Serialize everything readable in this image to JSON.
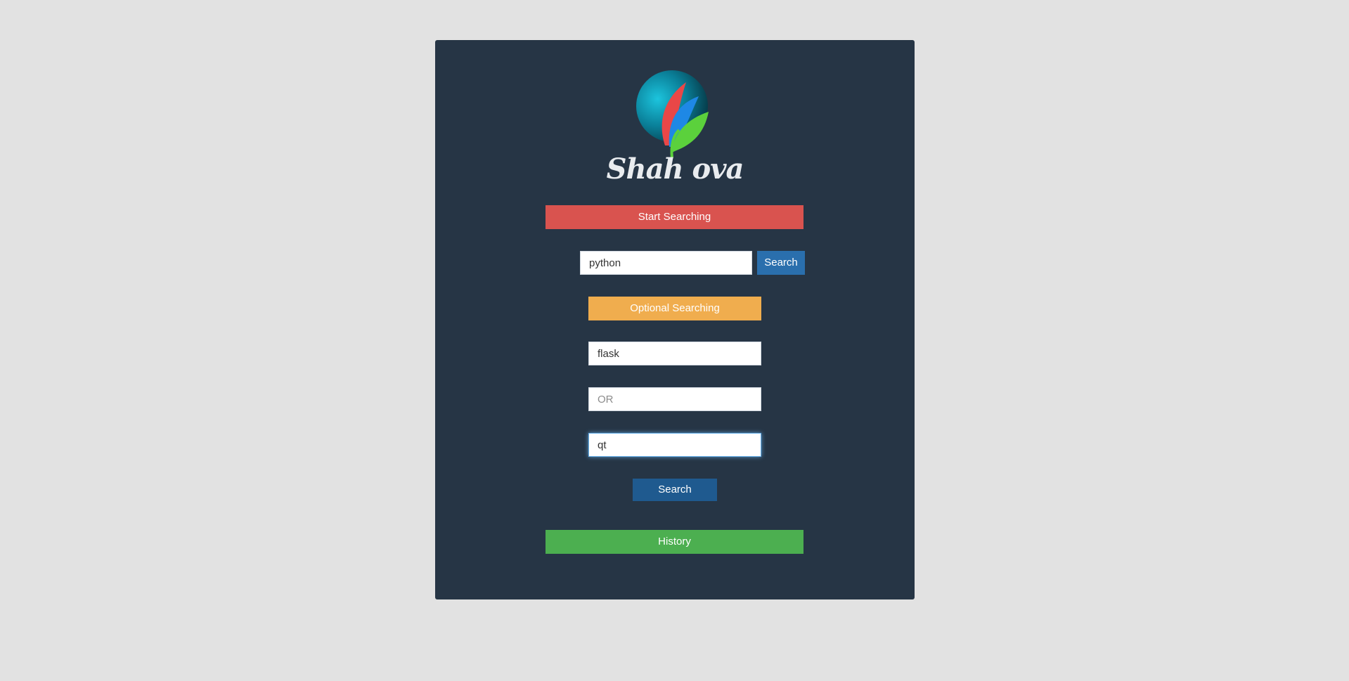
{
  "brand": {
    "name": "Shah ova"
  },
  "buttons": {
    "start_searching": "Start Searching",
    "search_inline": "Search",
    "optional_searching": "Optional Searching",
    "search_main": "Search",
    "history": "History"
  },
  "inputs": {
    "main_query": {
      "value": "python"
    },
    "optional_1": {
      "value": "flask"
    },
    "optional_2": {
      "value": "",
      "placeholder": "OR"
    },
    "optional_3": {
      "value": "qt"
    }
  },
  "colors": {
    "page_bg": "#e2e2e2",
    "panel_bg": "#263545",
    "start": "#d9534f",
    "optional": "#f0ad4e",
    "history": "#4caf50",
    "primary": "#2a6fad"
  },
  "icons": {
    "logo": "leaf-globe-logo"
  }
}
